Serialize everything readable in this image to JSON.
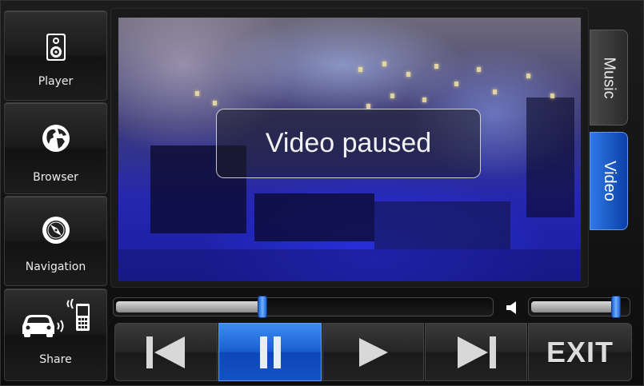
{
  "sidebar": {
    "items": [
      {
        "label": "Player",
        "icon": "speaker-icon"
      },
      {
        "label": "Browser",
        "icon": "globe-icon"
      },
      {
        "label": "Navigation",
        "icon": "compass-icon"
      },
      {
        "label": "Share",
        "icon": "car-phone-icon"
      }
    ]
  },
  "video": {
    "status": "Video paused"
  },
  "tabs": [
    {
      "label": "Music",
      "active": false
    },
    {
      "label": "Video",
      "active": true
    }
  ],
  "playback": {
    "progress": 0.39,
    "volume": 0.88,
    "volume_icon": "speaker-volume-icon"
  },
  "controls": {
    "prev_icon": "skip-previous-icon",
    "pause_icon": "pause-icon",
    "play_icon": "play-icon",
    "next_icon": "skip-next-icon",
    "exit_label": "EXIT"
  },
  "colors": {
    "accent": "#1a5fd0",
    "accent_light": "#3d8cf2"
  }
}
